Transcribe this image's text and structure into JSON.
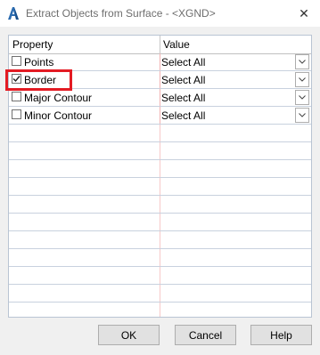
{
  "window": {
    "title": "Extract Objects from Surface - <XGND>",
    "close_glyph": "✕"
  },
  "grid": {
    "headers": {
      "property": "Property",
      "value": "Value"
    },
    "rows": [
      {
        "label": "Points",
        "checked": false,
        "value": "Select All"
      },
      {
        "label": "Border",
        "checked": true,
        "value": "Select All"
      },
      {
        "label": "Major Contour",
        "checked": false,
        "value": "Select All"
      },
      {
        "label": "Minor Contour",
        "checked": false,
        "value": "Select All"
      }
    ]
  },
  "buttons": {
    "ok": "OK",
    "cancel": "Cancel",
    "help": "Help"
  },
  "colors": {
    "highlight": "#e31b23",
    "app_icon": "#2b6cb0"
  }
}
